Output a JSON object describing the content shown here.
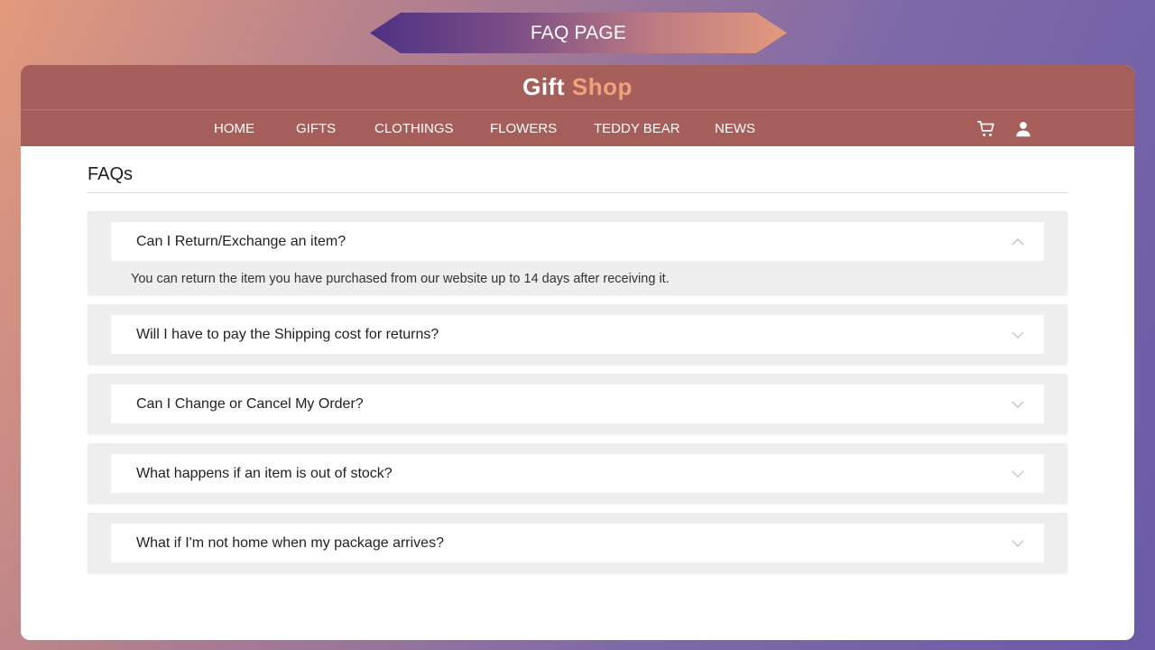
{
  "banner": {
    "title": "FAQ PAGE"
  },
  "brand": {
    "part1": "Gift",
    "part2": "Shop"
  },
  "nav": {
    "items": [
      "HOME",
      "GIFTS",
      "CLOTHINGS",
      "FLOWERS",
      "TEDDY BEAR",
      "NEWS"
    ],
    "icons": [
      "cart-icon",
      "user-icon"
    ]
  },
  "page": {
    "title": "FAQs"
  },
  "faqs": [
    {
      "question": "Can I Return/Exchange an item?",
      "answer": "You can return the item you have purchased from our website up to 14 days after receiving it.",
      "expanded": true
    },
    {
      "question": "Will I have to pay the Shipping cost for returns?",
      "expanded": false
    },
    {
      "question": "Can I Change or Cancel My Order?",
      "expanded": false
    },
    {
      "question": "What happens if an item is out of stock?",
      "expanded": false
    },
    {
      "question": "What if I'm not home when my package arrives?",
      "expanded": false
    }
  ],
  "colors": {
    "header_bg": "#a55e5a",
    "brand_accent": "#f0a27c",
    "faq_bg": "#eeeeee"
  }
}
